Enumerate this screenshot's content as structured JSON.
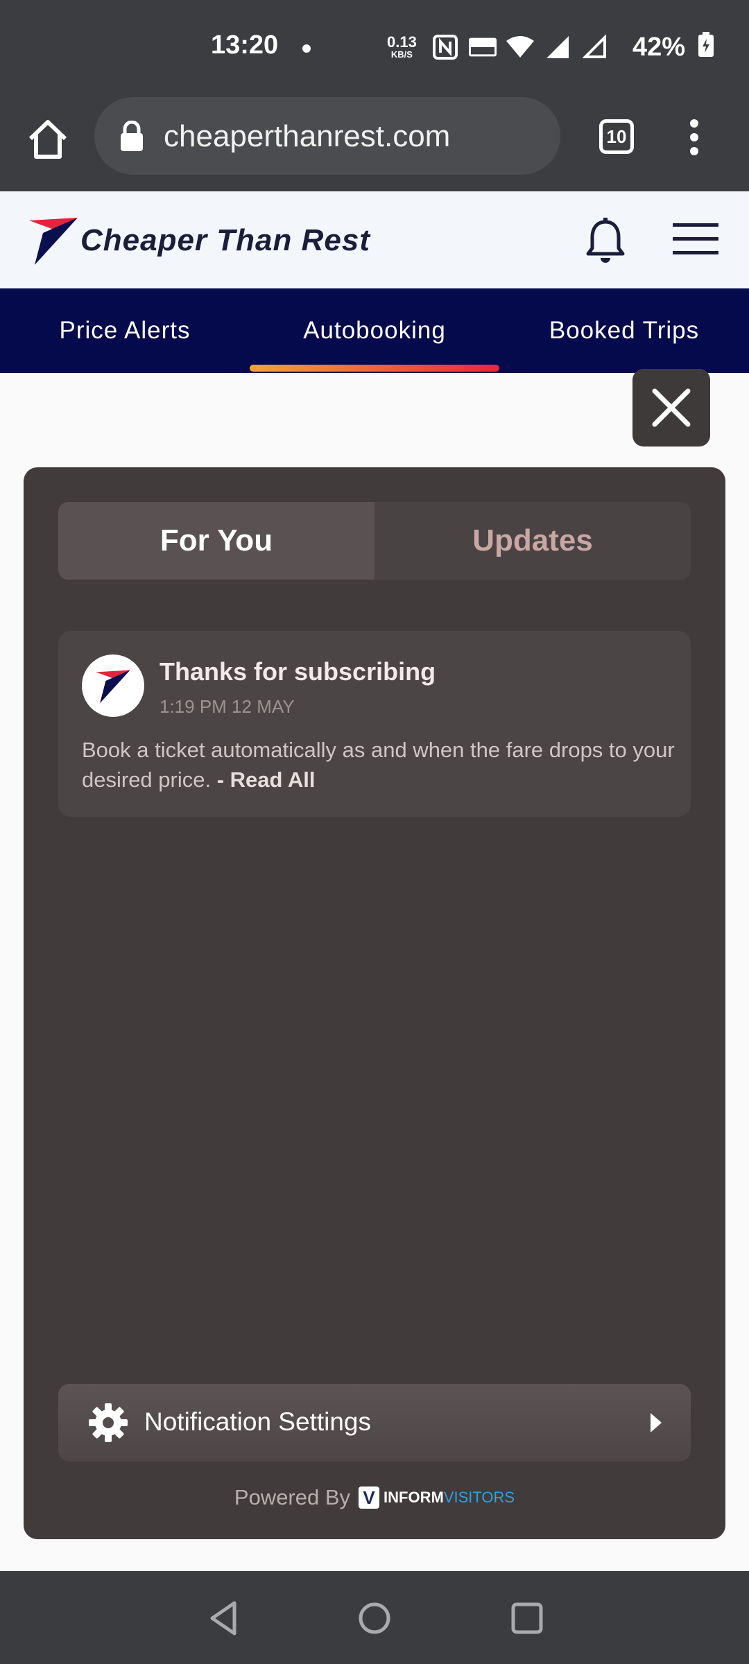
{
  "status_bar": {
    "time": "13:20",
    "net_speed": "0.13",
    "net_unit": "KB/S",
    "battery": "42%"
  },
  "browser": {
    "url": "cheaperthanrest.com",
    "tab_count": "10"
  },
  "site": {
    "brand_name": "Cheaper Than Rest",
    "nav_tabs": [
      {
        "label": "Price Alerts"
      },
      {
        "label": "Autobooking"
      },
      {
        "label": "Booked Trips"
      }
    ],
    "active_tab": "Autobooking"
  },
  "panel": {
    "tabs": [
      {
        "label": "For You"
      },
      {
        "label": "Updates"
      }
    ],
    "notification": {
      "title": "Thanks for subscribing",
      "time": "1:19 PM 12 MAY",
      "body": "Book a ticket automatically as and when the fare drops to your desired price. ",
      "read_all": "- Read All"
    },
    "settings_label": "Notification Settings",
    "powered_by": "Powered By",
    "powered_brand_a": "INFORM",
    "powered_brand_b": "VISITORS"
  },
  "colors": {
    "nav_bg": "#050a4d",
    "panel_bg": "#413b3b",
    "accent_gradient_start": "#f7a13a",
    "accent_gradient_end": "#f0233c"
  },
  "icons": [
    "home-icon",
    "lock-icon",
    "tabs-icon",
    "more-vert-icon",
    "bell-icon",
    "hamburger-icon",
    "close-icon",
    "gear-icon",
    "chevron-right-icon",
    "back-icon",
    "home-nav-icon",
    "recents-icon"
  ]
}
